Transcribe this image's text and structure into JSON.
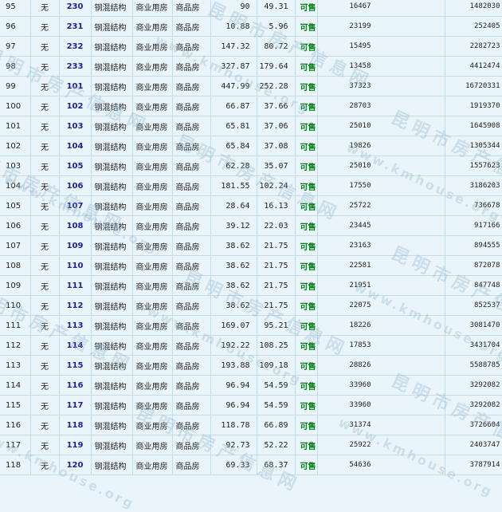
{
  "units": [
    {
      "no": "95",
      "none": "无",
      "room": "230",
      "structure": "钢混结构",
      "use": "商业用房",
      "kind": "商品房",
      "area": "90",
      "inner_area": "49.31",
      "status": "可售",
      "price": "16467",
      "total": "1482030"
    },
    {
      "no": "96",
      "none": "无",
      "room": "231",
      "structure": "钢混结构",
      "use": "商业用房",
      "kind": "商品房",
      "area": "10.88",
      "inner_area": "5.96",
      "status": "可售",
      "price": "23199",
      "total": "252405"
    },
    {
      "no": "97",
      "none": "无",
      "room": "232",
      "structure": "钢混结构",
      "use": "商业用房",
      "kind": "商品房",
      "area": "147.32",
      "inner_area": "80.72",
      "status": "可售",
      "price": "15495",
      "total": "2282723"
    },
    {
      "no": "98",
      "none": "无",
      "room": "233",
      "structure": "钢混结构",
      "use": "商业用房",
      "kind": "商品房",
      "area": "327.87",
      "inner_area": "179.64",
      "status": "可售",
      "price": "13458",
      "total": "4412474"
    },
    {
      "no": "99",
      "none": "无",
      "room": "101",
      "structure": "钢混结构",
      "use": "商业用房",
      "kind": "商品房",
      "area": "447.99",
      "inner_area": "252.28",
      "status": "可售",
      "price": "37323",
      "total": "16720331"
    },
    {
      "no": "100",
      "none": "无",
      "room": "102",
      "structure": "钢混结构",
      "use": "商业用房",
      "kind": "商品房",
      "area": "66.87",
      "inner_area": "37.66",
      "status": "可售",
      "price": "28703",
      "total": "1919370"
    },
    {
      "no": "101",
      "none": "无",
      "room": "103",
      "structure": "钢混结构",
      "use": "商业用房",
      "kind": "商品房",
      "area": "65.81",
      "inner_area": "37.06",
      "status": "可售",
      "price": "25010",
      "total": "1645908"
    },
    {
      "no": "102",
      "none": "无",
      "room": "104",
      "structure": "钢混结构",
      "use": "商业用房",
      "kind": "商品房",
      "area": "65.84",
      "inner_area": "37.08",
      "status": "可售",
      "price": "19826",
      "total": "1305344"
    },
    {
      "no": "103",
      "none": "无",
      "room": "105",
      "structure": "钢混结构",
      "use": "商业用房",
      "kind": "商品房",
      "area": "62.28",
      "inner_area": "35.07",
      "status": "可售",
      "price": "25010",
      "total": "1557623"
    },
    {
      "no": "104",
      "none": "无",
      "room": "106",
      "structure": "钢混结构",
      "use": "商业用房",
      "kind": "商品房",
      "area": "181.55",
      "inner_area": "102.24",
      "status": "可售",
      "price": "17550",
      "total": "3186203"
    },
    {
      "no": "105",
      "none": "无",
      "room": "107",
      "structure": "钢混结构",
      "use": "商业用房",
      "kind": "商品房",
      "area": "28.64",
      "inner_area": "16.13",
      "status": "可售",
      "price": "25722",
      "total": "736678"
    },
    {
      "no": "106",
      "none": "无",
      "room": "108",
      "structure": "钢混结构",
      "use": "商业用房",
      "kind": "商品房",
      "area": "39.12",
      "inner_area": "22.03",
      "status": "可售",
      "price": "23445",
      "total": "917166"
    },
    {
      "no": "107",
      "none": "无",
      "room": "109",
      "structure": "钢混结构",
      "use": "商业用房",
      "kind": "商品房",
      "area": "38.62",
      "inner_area": "21.75",
      "status": "可售",
      "price": "23163",
      "total": "894555"
    },
    {
      "no": "108",
      "none": "无",
      "room": "110",
      "structure": "钢混结构",
      "use": "商业用房",
      "kind": "商品房",
      "area": "38.62",
      "inner_area": "21.75",
      "status": "可售",
      "price": "22581",
      "total": "872078"
    },
    {
      "no": "109",
      "none": "无",
      "room": "111",
      "structure": "钢混结构",
      "use": "商业用房",
      "kind": "商品房",
      "area": "38.62",
      "inner_area": "21.75",
      "status": "可售",
      "price": "21951",
      "total": "847748"
    },
    {
      "no": "110",
      "none": "无",
      "room": "112",
      "structure": "钢混结构",
      "use": "商业用房",
      "kind": "商品房",
      "area": "38.62",
      "inner_area": "21.75",
      "status": "可售",
      "price": "22075",
      "total": "852537"
    },
    {
      "no": "111",
      "none": "无",
      "room": "113",
      "structure": "钢混结构",
      "use": "商业用房",
      "kind": "商品房",
      "area": "169.07",
      "inner_area": "95.21",
      "status": "可售",
      "price": "18226",
      "total": "3081470"
    },
    {
      "no": "112",
      "none": "无",
      "room": "114",
      "structure": "钢混结构",
      "use": "商业用房",
      "kind": "商品房",
      "area": "192.22",
      "inner_area": "108.25",
      "status": "可售",
      "price": "17853",
      "total": "3431704"
    },
    {
      "no": "113",
      "none": "无",
      "room": "115",
      "structure": "钢混结构",
      "use": "商业用房",
      "kind": "商品房",
      "area": "193.88",
      "inner_area": "109.18",
      "status": "可售",
      "price": "28826",
      "total": "5588785"
    },
    {
      "no": "114",
      "none": "无",
      "room": "116",
      "structure": "钢混结构",
      "use": "商业用房",
      "kind": "商品房",
      "area": "96.94",
      "inner_area": "54.59",
      "status": "可售",
      "price": "33960",
      "total": "3292082"
    },
    {
      "no": "115",
      "none": "无",
      "room": "117",
      "structure": "钢混结构",
      "use": "商业用房",
      "kind": "商品房",
      "area": "96.94",
      "inner_area": "54.59",
      "status": "可售",
      "price": "33960",
      "total": "3292082"
    },
    {
      "no": "116",
      "none": "无",
      "room": "118",
      "structure": "钢混结构",
      "use": "商业用房",
      "kind": "商品房",
      "area": "118.78",
      "inner_area": "66.89",
      "status": "可售",
      "price": "31374",
      "total": "3726604"
    },
    {
      "no": "117",
      "none": "无",
      "room": "119",
      "structure": "钢混结构",
      "use": "商业用房",
      "kind": "商品房",
      "area": "92.73",
      "inner_area": "52.22",
      "status": "可售",
      "price": "25922",
      "total": "2403747"
    },
    {
      "no": "118",
      "none": "无",
      "room": "120",
      "structure": "钢混结构",
      "use": "商业用房",
      "kind": "商品房",
      "area": "69.33",
      "inner_area": "68.37",
      "status": "可售",
      "price": "54636",
      "total": "3787914"
    }
  ],
  "watermark": {
    "cn": "昆明市房产信息网",
    "en": "www.kmhouse.org"
  }
}
